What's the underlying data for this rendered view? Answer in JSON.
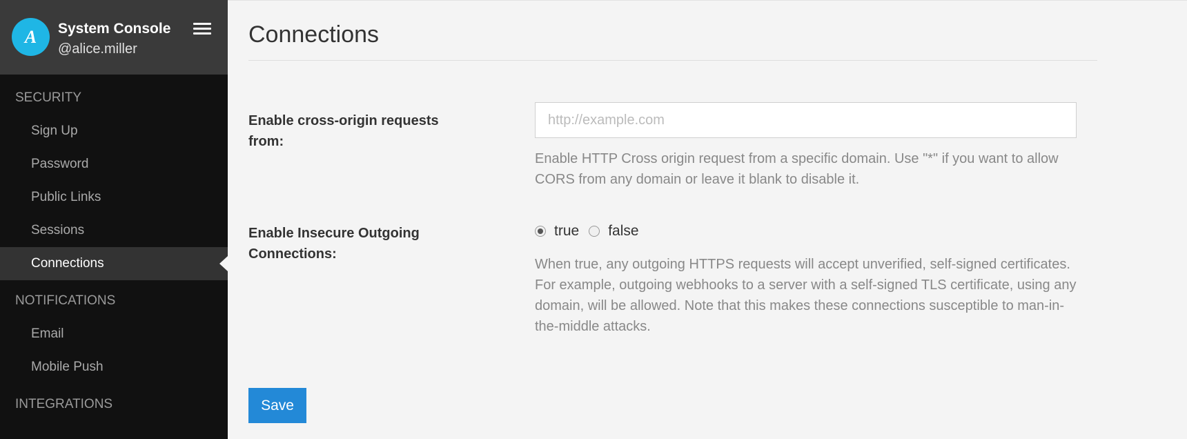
{
  "sidebar": {
    "avatar_letter": "A",
    "team_name": "System Console",
    "user_name": "@alice.miller",
    "sections": [
      {
        "title": "SECURITY",
        "items": [
          "Sign Up",
          "Password",
          "Public Links",
          "Sessions",
          "Connections"
        ]
      },
      {
        "title": "NOTIFICATIONS",
        "items": [
          "Email",
          "Mobile Push"
        ]
      },
      {
        "title": "INTEGRATIONS"
      }
    ],
    "active_item": "Connections"
  },
  "main": {
    "title": "Connections",
    "cors": {
      "label": "Enable cross-origin requests from:",
      "placeholder": "http://example.com",
      "value": "",
      "help": "Enable HTTP Cross origin request from a specific domain. Use \"*\" if you want to allow CORS from any domain or leave it blank to disable it."
    },
    "insecure": {
      "label": "Enable Insecure Outgoing Connections:",
      "options": [
        "true",
        "false"
      ],
      "selected": "true",
      "help": "When true, any outgoing HTTPS requests will accept unverified, self-signed certificates. For example, outgoing webhooks to a server with a self-signed TLS certificate, using any domain, will be allowed. Note that this makes these connections susceptible to man-in-the-middle attacks."
    },
    "save_label": "Save"
  },
  "colors": {
    "accent": "#2389d7",
    "avatar": "#1fb6e5",
    "sidebar_bg": "#111111",
    "sidebar_header_bg": "#3a3a3a"
  },
  "icons": [
    "menu-icon"
  ]
}
